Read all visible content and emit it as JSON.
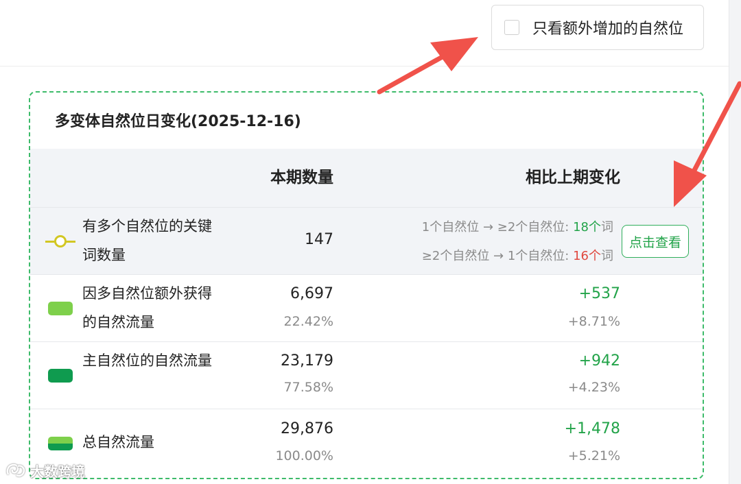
{
  "filter": {
    "label": "只看额外增加的自然位",
    "checked": false
  },
  "card": {
    "title": "多变体自然位日变化(2025-12-16)",
    "columns": {
      "current": "本期数量",
      "change": "相比上期变化"
    },
    "keyword_row": {
      "label": "有多个自然位的关键词数量",
      "legend_color": "#d2c723",
      "value": "147",
      "transitions": [
        {
          "text": "1个自然位 → ≥2个自然位: ",
          "count": "18个",
          "suffix": "词",
          "color": "#22a349"
        },
        {
          "text": "≥2个自然位 → 1个自然位: ",
          "count": "16个",
          "suffix": "词",
          "color": "#e0483e"
        }
      ],
      "view_button": "点击查看"
    },
    "rows": [
      {
        "label": "因多自然位额外获得的自然流量",
        "legend_color": "#7ed04b",
        "value": "6,697",
        "share": "22.42%",
        "change": "+537",
        "change_pct": "+8.71%"
      },
      {
        "label": "主自然位的自然流量",
        "legend_color": "#0f9b4f",
        "value": "23,179",
        "share": "77.58%",
        "change": "+942",
        "change_pct": "+4.23%"
      },
      {
        "label": "总自然流量",
        "legend_color_top": "#7ed04b",
        "legend_color_bottom": "#0f9b4f",
        "value": "29,876",
        "share": "100.00%",
        "change": "+1,478",
        "change_pct": "+5.21%"
      }
    ]
  },
  "colors": {
    "positive": "#22a349",
    "negative": "#e0483e",
    "card_border": "#3dbb6a",
    "arrow": "#f0524a"
  },
  "watermark": "大数跨境"
}
